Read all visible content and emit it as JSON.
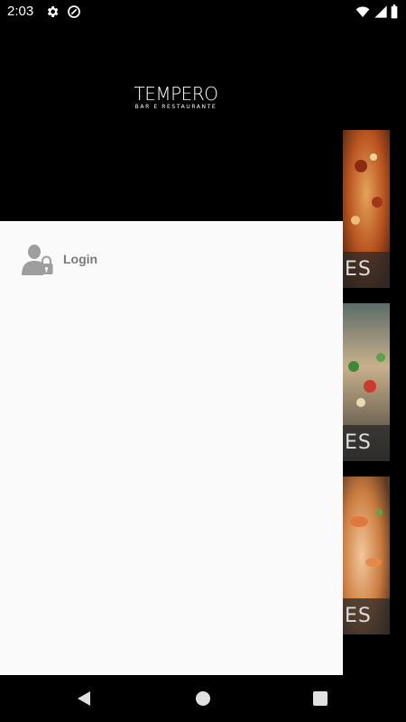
{
  "status_bar": {
    "time": "2:03",
    "icons": [
      "settings-gear-icon",
      "data-saver-icon",
      "wifi-icon",
      "signal-icon",
      "battery-icon"
    ]
  },
  "drawer": {
    "logo": {
      "name": "TEMPERO",
      "tagline": "BAR E RESTAURANTE"
    },
    "menu_items": [
      {
        "label": "Login",
        "icon": "user-lock-icon"
      }
    ]
  },
  "background": {
    "cards": [
      {
        "caption": "ES"
      },
      {
        "caption": "ES"
      },
      {
        "caption": "ES"
      }
    ]
  },
  "nav_bar": {
    "buttons": [
      "back-icon",
      "home-icon",
      "recents-icon"
    ]
  },
  "colors": {
    "drawer_background": "#fafafa",
    "header_background": "#000000",
    "menu_text": "#7a7a7a",
    "icon_gray": "#9e9e9e"
  }
}
